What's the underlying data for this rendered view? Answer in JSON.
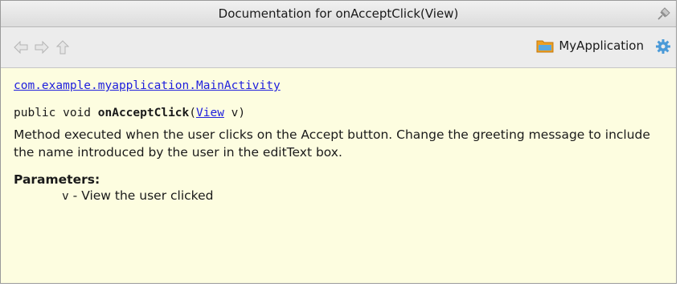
{
  "window": {
    "title": "Documentation for onAcceptClick(View)"
  },
  "toolbar": {
    "back_icon": "arrow-left-icon",
    "forward_icon": "arrow-right-icon",
    "up_icon": "arrow-up-icon",
    "project_name": "MyApplication",
    "project_icon": "folder-icon",
    "settings_icon": "gear-icon"
  },
  "doc": {
    "class_link": "com.example.myapplication.MainActivity",
    "signature": {
      "prefix": "public void ",
      "method": "onAcceptClick",
      "open_paren": "(",
      "param_type": "View",
      "param_rest": " v)"
    },
    "description": "Method executed when the user clicks on the Accept button. Change the greeting message to include the name introduced by the user in the editText box.",
    "params_heading": "Parameters:",
    "params": [
      {
        "name": "v",
        "separator": " - ",
        "desc": "View the user clicked"
      }
    ]
  },
  "colors": {
    "link": "#2020dd",
    "background": "#fdfde0",
    "accent_folder": "#f0a020",
    "accent_gear": "#4a9ad8"
  }
}
